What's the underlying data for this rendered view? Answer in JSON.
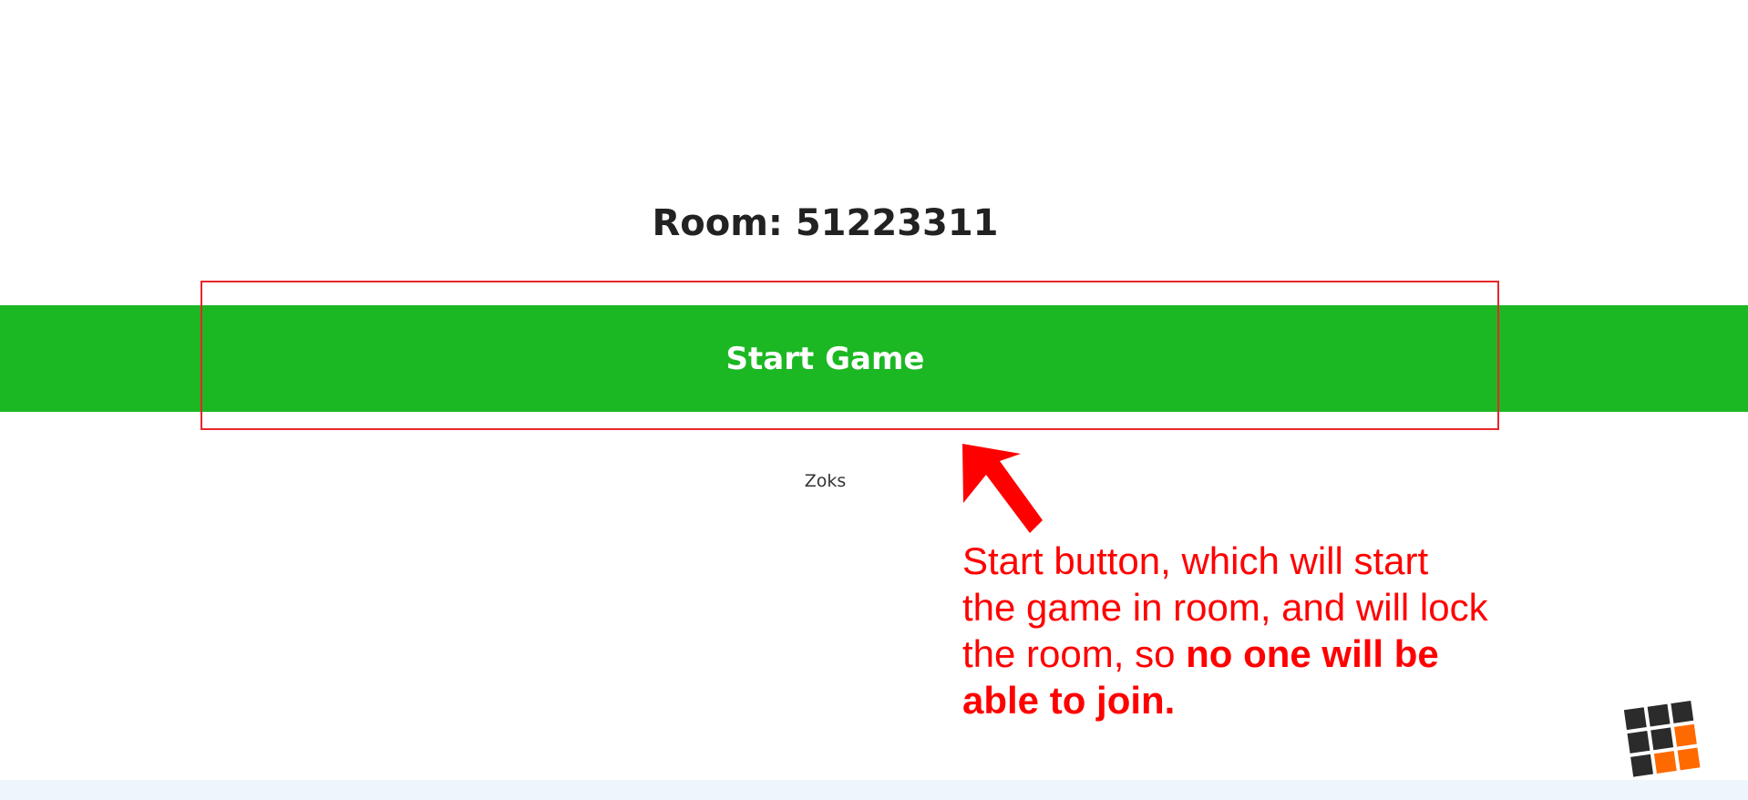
{
  "room": {
    "label": "Room: 51223311"
  },
  "start_button": {
    "label": "Start Game"
  },
  "players": [
    "Zoks"
  ],
  "annotation": {
    "text_regular": "Start button, which will start the game in room, and will lock the room, so ",
    "text_bold": "no one will be able to join."
  },
  "colors": {
    "button": "#1bb823",
    "annotation": "#ff0000",
    "logo_dark": "#2b2b2b",
    "logo_accent": "#ff6a00"
  }
}
